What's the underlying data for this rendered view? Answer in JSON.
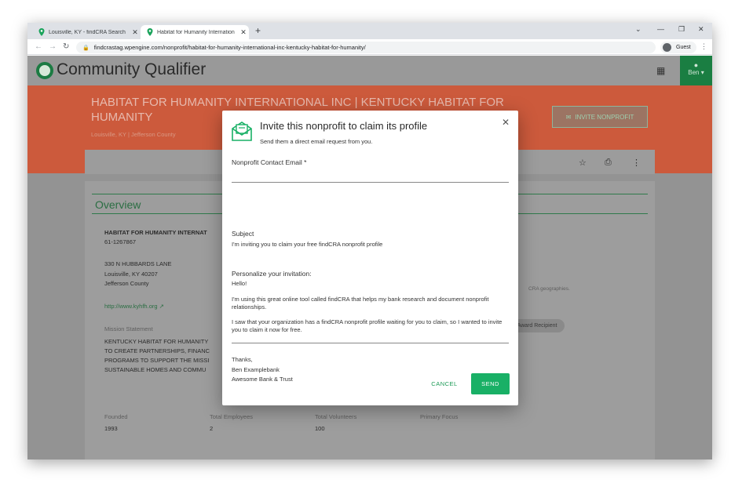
{
  "browser": {
    "tabs": [
      {
        "label": "Louisville, KY - findCRA Search",
        "close": "✕"
      },
      {
        "label": "Habitat for Humanity Internation",
        "close": "✕"
      }
    ],
    "new_tab": "+",
    "url": "findcrastag.wpengine.com/nonprofit/habitat-for-humanity-international-inc-kentucky-habitat-for-humanity/",
    "profile": "Guest"
  },
  "app": {
    "name": "Community Qualifier",
    "user": "Ben"
  },
  "nonprofit": {
    "title": "HABITAT FOR HUMANITY INTERNATIONAL INC | KENTUCKY HABITAT FOR HUMANITY",
    "location": "Louisville, KY | Jefferson County",
    "invite_button": "INVITE NONPROFIT",
    "overview_title": "Overview",
    "name_short": "HABITAT FOR HUMANITY INTERNAT",
    "ein": "61-1267867",
    "address_line1": "330 N HUBBARDS LANE",
    "address_line2": "Louisville, KY 40207",
    "county": "Jefferson County",
    "website": "http://www.kyhfh.org",
    "mission_label": "Mission Statement",
    "mission_lines": [
      "KENTUCKY HABITAT FOR HUMANITY",
      "TO CREATE PARTNERSHIPS, FINANC",
      "PROGRAMS TO SUPPORT THE MISSI",
      "SUSTAINABLE HOMES AND COMMU"
    ],
    "geo_note": "CRA geographies.",
    "award_pill": "Award Recipient",
    "stats": [
      {
        "label": "Founded",
        "value": "1993"
      },
      {
        "label": "Total Employees",
        "value": "2"
      },
      {
        "label": "Total Volunteers",
        "value": "100"
      },
      {
        "label": "Primary Focus",
        "value": ""
      }
    ]
  },
  "modal": {
    "title": "Invite this nonprofit to claim its profile",
    "subtitle": "Send them a direct email request from you.",
    "email_label": "Nonprofit Contact Email *",
    "email_value": "",
    "subject_label": "Subject",
    "subject_value": "I'm inviting you to claim your free findCRA nonprofit profile",
    "personalize_label": "Personalize your invitation:",
    "body_greeting": "Hello!",
    "body_p1": "I'm using this great online tool called findCRA that helps my bank research and document nonprofit relationships.",
    "body_p2": "I saw that your organization has a findCRA nonprofit profile waiting for you to claim, so I wanted to invite you to claim it now for free.",
    "signoff": "Thanks,",
    "signer_name": "Ben Examplebank",
    "signer_org": "Awesome Bank & Trust",
    "cancel": "CANCEL",
    "send": "SEND"
  },
  "colors": {
    "accent_green": "#19b066",
    "hero_orange": "#cc5a3c",
    "brand_green": "#1a7e42"
  }
}
